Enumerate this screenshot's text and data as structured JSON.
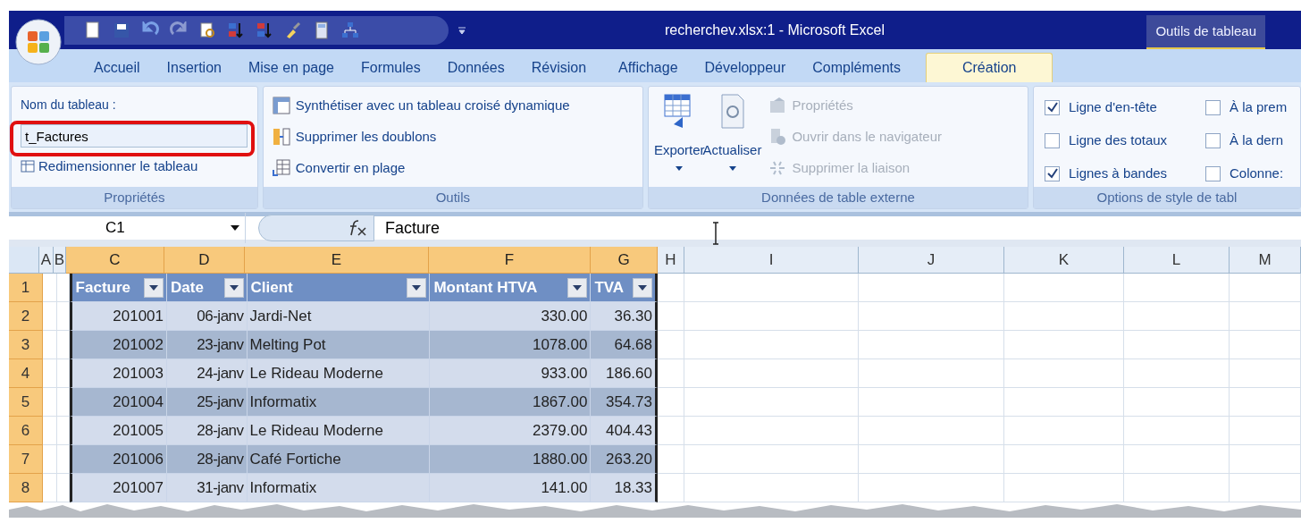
{
  "window": {
    "title": "recherchev.xlsx:1 - Microsoft Excel",
    "contextual_tab": "Outils de tableau"
  },
  "tabs": [
    {
      "label": "Accueil",
      "selected": false
    },
    {
      "label": "Insertion",
      "selected": false
    },
    {
      "label": "Mise en page",
      "selected": false
    },
    {
      "label": "Formules",
      "selected": false
    },
    {
      "label": "Données",
      "selected": false
    },
    {
      "label": "Révision",
      "selected": false
    },
    {
      "label": "Affichage",
      "selected": false
    },
    {
      "label": "Développeur",
      "selected": false
    },
    {
      "label": "Compléments",
      "selected": false
    },
    {
      "label": "Création",
      "selected": true
    }
  ],
  "ribbon": {
    "properties": {
      "label": "Nom du tableau :",
      "table_name": "t_Factures",
      "resize_button": "Redimensionner le tableau",
      "title": "Propriétés"
    },
    "tools": {
      "buttons": [
        "Synthétiser avec un tableau croisé dynamique",
        "Supprimer les doublons",
        "Convertir en plage"
      ],
      "title": "Outils"
    },
    "external": {
      "large_buttons": [
        "Exporter",
        "Actualiser"
      ],
      "small_buttons": [
        {
          "label": "Propriétés",
          "disabled": true
        },
        {
          "label": "Ouvrir dans le navigateur",
          "disabled": true
        },
        {
          "label": "Supprimer la liaison",
          "disabled": true
        }
      ],
      "title": "Données de table externe"
    },
    "style_options": {
      "checkboxes": [
        {
          "label": "Ligne d'en-tête",
          "checked": true
        },
        {
          "label": "À la prem",
          "checked": false
        },
        {
          "label": "Ligne des totaux",
          "checked": false
        },
        {
          "label": "À la dern",
          "checked": false
        },
        {
          "label": "Lignes à bandes",
          "checked": true
        },
        {
          "label": "Colonne:",
          "checked": false
        }
      ],
      "title": "Options de style de tabl"
    }
  },
  "formula_bar": {
    "name_box": "C1",
    "formula": "Facture"
  },
  "columns": [
    {
      "label": "A",
      "selected": false
    },
    {
      "label": "B",
      "selected": false
    },
    {
      "label": "C",
      "selected": true
    },
    {
      "label": "D",
      "selected": true
    },
    {
      "label": "E",
      "selected": true
    },
    {
      "label": "F",
      "selected": true
    },
    {
      "label": "G",
      "selected": true
    },
    {
      "label": "H",
      "selected": false
    },
    {
      "label": "I",
      "selected": false
    },
    {
      "label": "J",
      "selected": false
    },
    {
      "label": "K",
      "selected": false
    },
    {
      "label": "L",
      "selected": false
    },
    {
      "label": "M",
      "selected": false
    }
  ],
  "row_numbers": [
    "1",
    "2",
    "3",
    "4",
    "5",
    "6",
    "7",
    "8"
  ],
  "table": {
    "headers": [
      "Facture",
      "Date",
      "Client",
      "Montant HTVA",
      "TVA"
    ],
    "rows": [
      [
        "201001",
        "06-janv",
        "Jardi-Net",
        "330.00",
        "36.30"
      ],
      [
        "201002",
        "23-janv",
        "Melting Pot",
        "1078.00",
        "64.68"
      ],
      [
        "201003",
        "24-janv",
        "Le Rideau Moderne",
        "933.00",
        "186.60"
      ],
      [
        "201004",
        "25-janv",
        "Informatix",
        "1867.00",
        "354.73"
      ],
      [
        "201005",
        "28-janv",
        "Le Rideau Moderne",
        "2379.00",
        "404.43"
      ],
      [
        "201006",
        "28-janv",
        "Café Fortiche",
        "1880.00",
        "263.20"
      ],
      [
        "201007",
        "31-janv",
        "Informatix",
        "141.00",
        "18.33"
      ]
    ]
  }
}
